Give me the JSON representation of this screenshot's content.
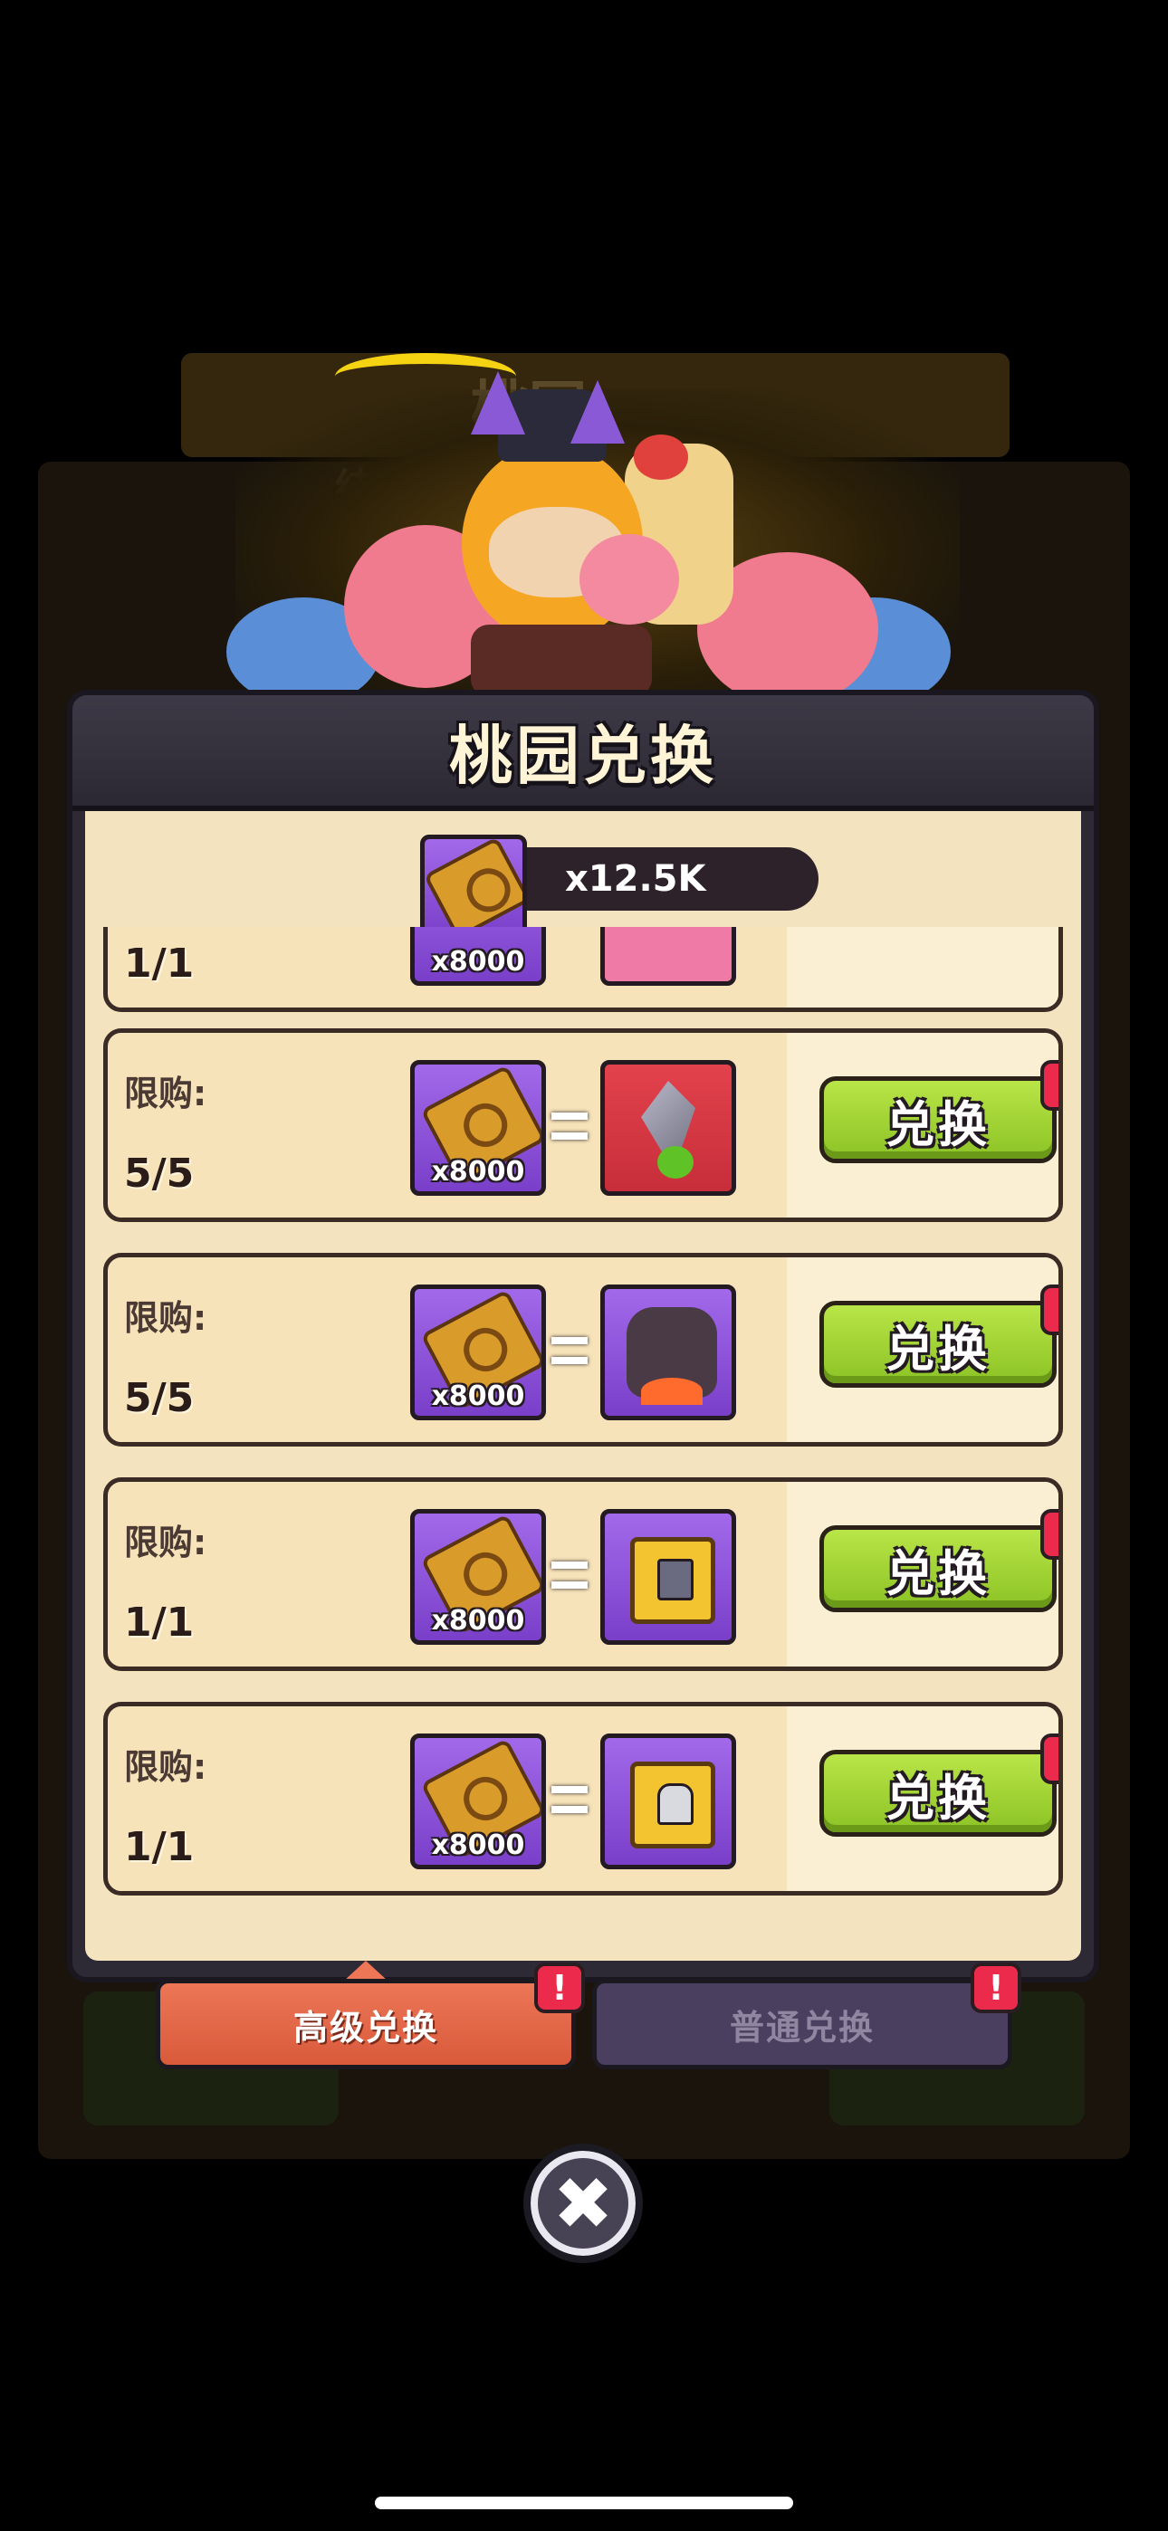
{
  "background": {
    "title": "桃园",
    "timer_prefix": "结束"
  },
  "modal": {
    "title": "桃园兑换"
  },
  "currency": {
    "icon": "scroll-icon",
    "amount": "x12.5K"
  },
  "partial_row": {
    "count": "1/1",
    "cost": "x8000"
  },
  "rows": [
    {
      "limit_label": "限购:",
      "count": "5/5",
      "cost": "x8000",
      "reward_icon": "dagger-icon",
      "button": "兑换",
      "badge": "!"
    },
    {
      "limit_label": "限购:",
      "count": "5/5",
      "cost": "x8000",
      "reward_icon": "golem-icon",
      "button": "兑换",
      "badge": "!"
    },
    {
      "limit_label": "限购:",
      "count": "1/1",
      "cost": "x8000",
      "reward_icon": "chest-icon",
      "button": "兑换",
      "badge": "!"
    },
    {
      "limit_label": "限购:",
      "count": "1/1",
      "cost": "x8000",
      "reward_icon": "chest-helmet-icon",
      "button": "兑换",
      "badge": "!"
    }
  ],
  "tabs": [
    {
      "label": "高级兑换",
      "active": true,
      "badge": "!"
    },
    {
      "label": "普通兑换",
      "active": false,
      "badge": "!"
    }
  ],
  "close": {
    "icon": "close-icon",
    "glyph": "✖"
  },
  "colors": {
    "accent_green": "#8cc326",
    "tab_active": "#d85a3b",
    "tab_inactive": "#4a3f5e",
    "badge_red": "#ec2a4c",
    "panel_bg": "#f4e3bf"
  }
}
